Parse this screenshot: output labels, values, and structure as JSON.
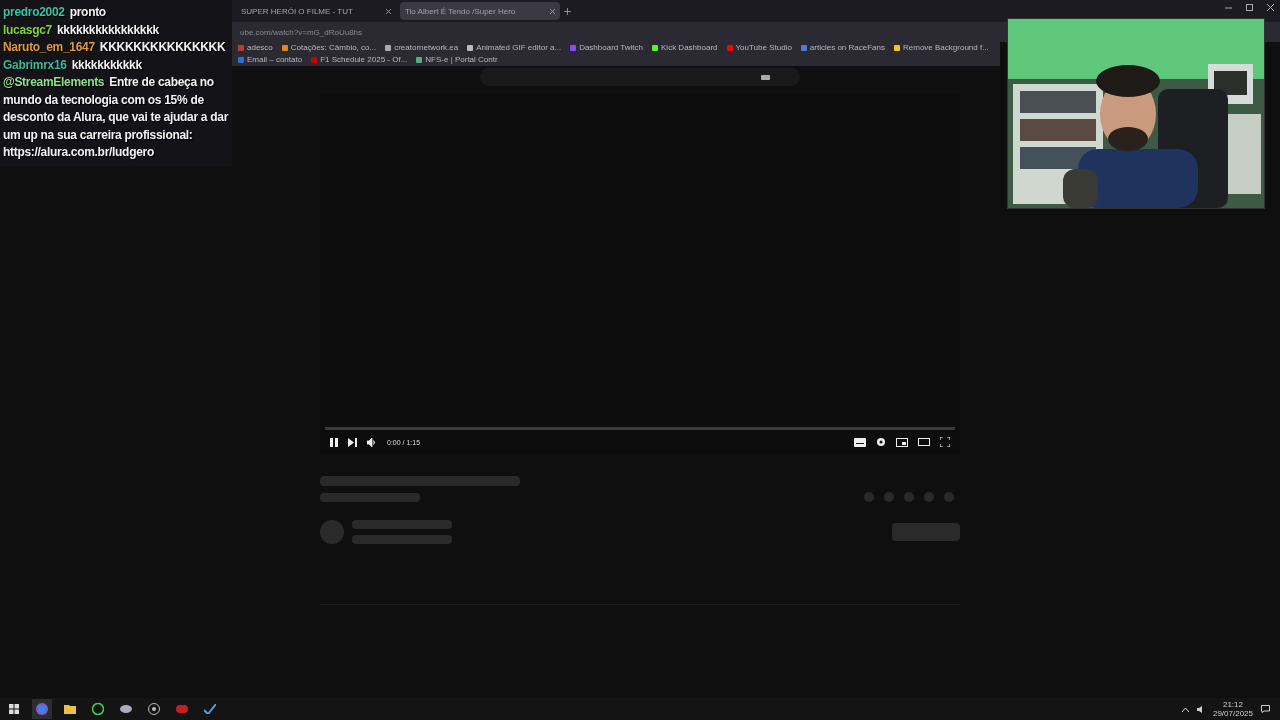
{
  "browser": {
    "tabs": [
      {
        "title": "SUPER HERÓI O FILME - TUT",
        "selected": false
      },
      {
        "title": "Tio Albert É Tendo /Super Hero",
        "selected": true
      }
    ],
    "address": "ube.com/watch?v=mG_dRoUu8hs",
    "bookmarks": [
      "adesco",
      "Cotações: Câmbio, co...",
      "creatornetwork.ea",
      "Animated GIF editor a...",
      "Dashboard Twitch",
      "Kick Dashboard",
      "YouTube Studio",
      "articles on RaceFans",
      "Remove Background f...",
      "Email – contato",
      "F1 Schedule 2025 - Of...",
      "NFS-e | Portal Contr"
    ]
  },
  "chat": {
    "messages": [
      {
        "user": "predro2002",
        "color": "#3cc3a0",
        "text": "pronto"
      },
      {
        "user": "lucasgc7",
        "color": "#7ed63a",
        "text": "kkkkkkkkkkkkkkkk"
      },
      {
        "user": "Naruto_em_1647",
        "color": "#e09a3a",
        "text": "KKKKKKKKKKKKKKK"
      },
      {
        "user": "Gabrimrx16",
        "color": "#3cb89a",
        "text": "kkkkkkkkkkk"
      },
      {
        "user": "@StreamElements",
        "color": "#8ee08a",
        "text": "Entre de cabeça no mundo da tecnologia com os 15% de desconto da Alura, que vai te ajudar a dar um up na sua carreira profissional: https://alura.com.br/ludgero"
      }
    ]
  },
  "player": {
    "time": "0:00 / 1:15"
  },
  "taskbar": {
    "time": "21:12",
    "date": "29/07/2025"
  }
}
